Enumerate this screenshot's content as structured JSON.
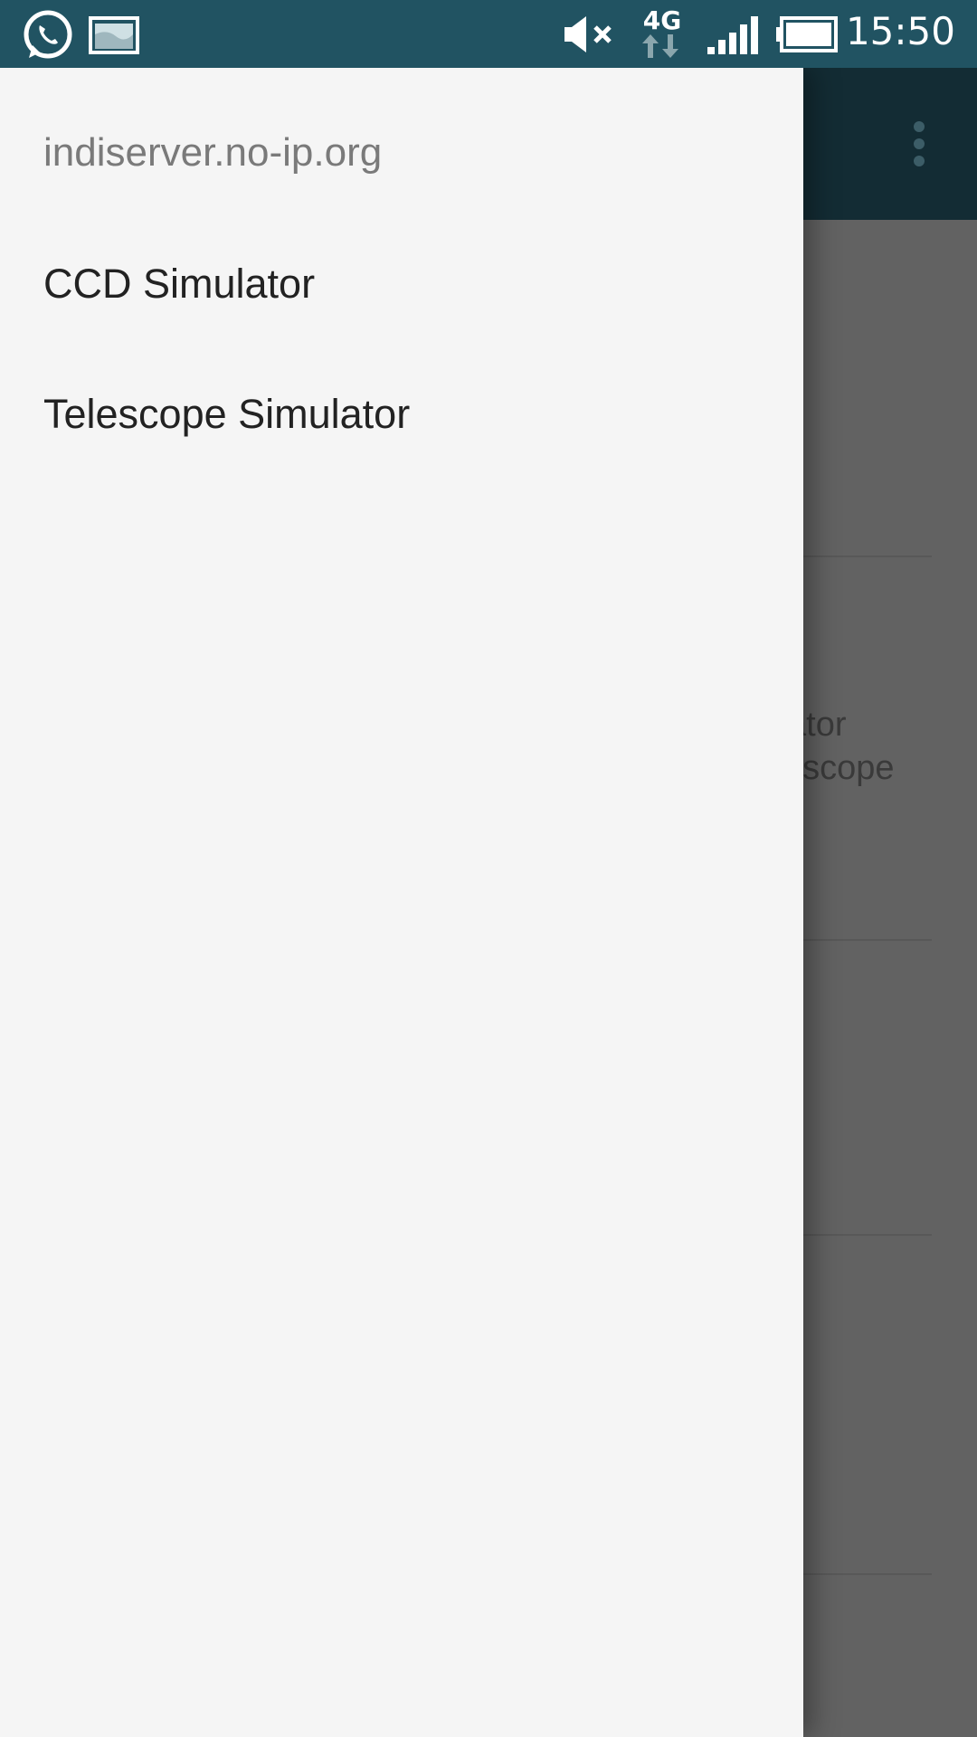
{
  "status_bar": {
    "time": "15:50",
    "network_type": "4G",
    "icons": [
      "whatsapp-icon",
      "gallery-icon",
      "mute-icon",
      "network-4g-icon",
      "signal-icon",
      "battery-icon"
    ],
    "background_color": "#215362"
  },
  "app_bar": {
    "menu_icon": "overflow-menu-icon",
    "background_color": "#132c34"
  },
  "drawer": {
    "header": "indiserver.no-ip.org",
    "items": [
      {
        "label": "CCD Simulator"
      },
      {
        "label": "Telescope Simulator"
      }
    ],
    "background_color": "#f5f5f5"
  },
  "background_content": {
    "fragments": [
      "ator",
      "escope"
    ]
  }
}
